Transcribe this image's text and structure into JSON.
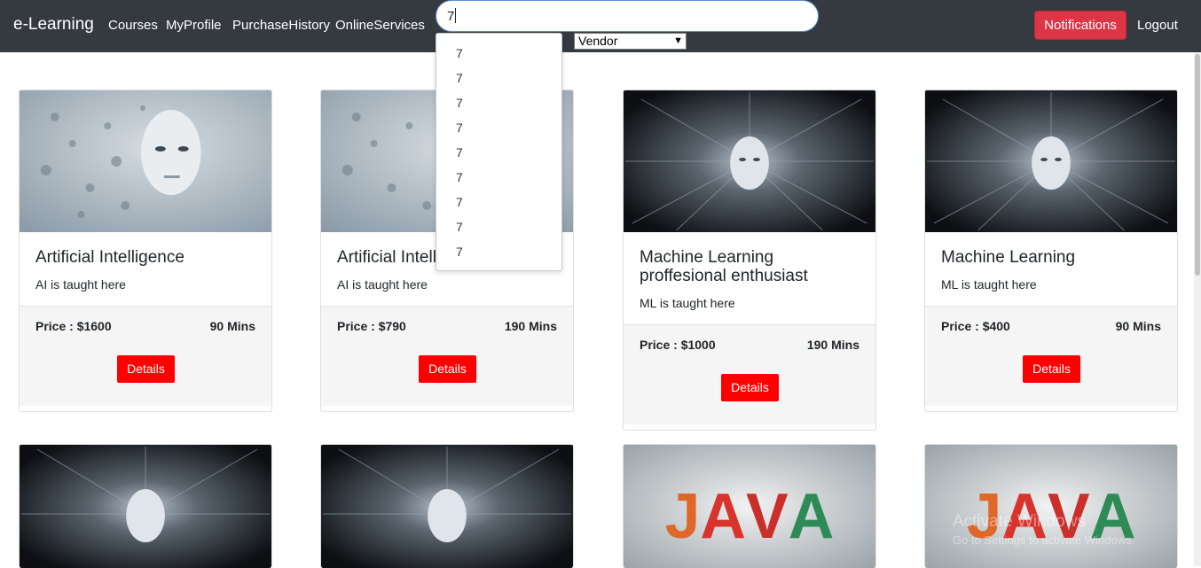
{
  "navbar": {
    "brand": "e-Learning",
    "links": [
      "Courses",
      "MyProfile",
      "PurchaseHistory",
      "OnlineServices"
    ],
    "search_value": "7",
    "vendor_select": "Vendor",
    "notifications_label": "Notifications",
    "logout_label": "Logout"
  },
  "dropdown": {
    "items": [
      "7",
      "7",
      "7",
      "7",
      "7",
      "7",
      "7",
      "7",
      "7"
    ]
  },
  "cards": [
    {
      "title": "Artificial Intelligence",
      "text": "AI is taught here",
      "price": "Price : $1600",
      "duration": "90 Mins",
      "details": "Details",
      "image": "ai-face-grey"
    },
    {
      "title": "Artificial Intelligence",
      "text": "AI is taught here",
      "price": "Price : $790",
      "duration": "190 Mins",
      "details": "Details",
      "image": "ai-face-grey"
    },
    {
      "title": "Machine Learning proffesional enthusiast",
      "text": "ML is taught here",
      "price": "Price : $1000",
      "duration": "190 Mins",
      "details": "Details",
      "image": "ai-face-burst"
    },
    {
      "title": "Machine Learning",
      "text": "ML is taught here",
      "price": "Price : $400",
      "duration": "90 Mins",
      "details": "Details",
      "image": "ai-face-burst"
    }
  ],
  "bottom_cards": [
    {
      "image": "ai-face-burst"
    },
    {
      "image": "ai-face-burst"
    },
    {
      "image": "java-logo",
      "logo_text": "JAVA"
    },
    {
      "image": "java-logo",
      "logo_text": "JAVA"
    }
  ],
  "watermark": {
    "line1": "Activate Windows",
    "line2": "Go to Settings to activate Windows."
  },
  "colors": {
    "navbar_bg": "#343a40",
    "notifications_bg": "#dc3545",
    "details_bg": "#ff0000"
  }
}
